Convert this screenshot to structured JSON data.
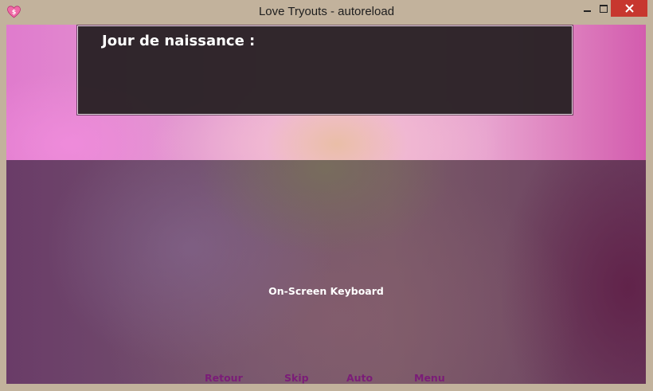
{
  "window": {
    "title": "Love Tryouts - autoreload",
    "icon": "heart-dollar-icon",
    "controls": {
      "minimize": "minimize-icon",
      "maximize": "maximize-icon",
      "close": "close-icon"
    }
  },
  "dialog": {
    "prompt": "Jour de naissance :"
  },
  "keyboard": {
    "label": "On-Screen Keyboard"
  },
  "quick_menu": {
    "items": [
      "Retour",
      "Skip",
      "Auto",
      "Menu"
    ]
  },
  "colors": {
    "quick_menu_text": "#7b1c78",
    "close_button": "#c7372f",
    "dialog_bg": "#2a2226",
    "dialog_border": "#e7d6e3"
  }
}
